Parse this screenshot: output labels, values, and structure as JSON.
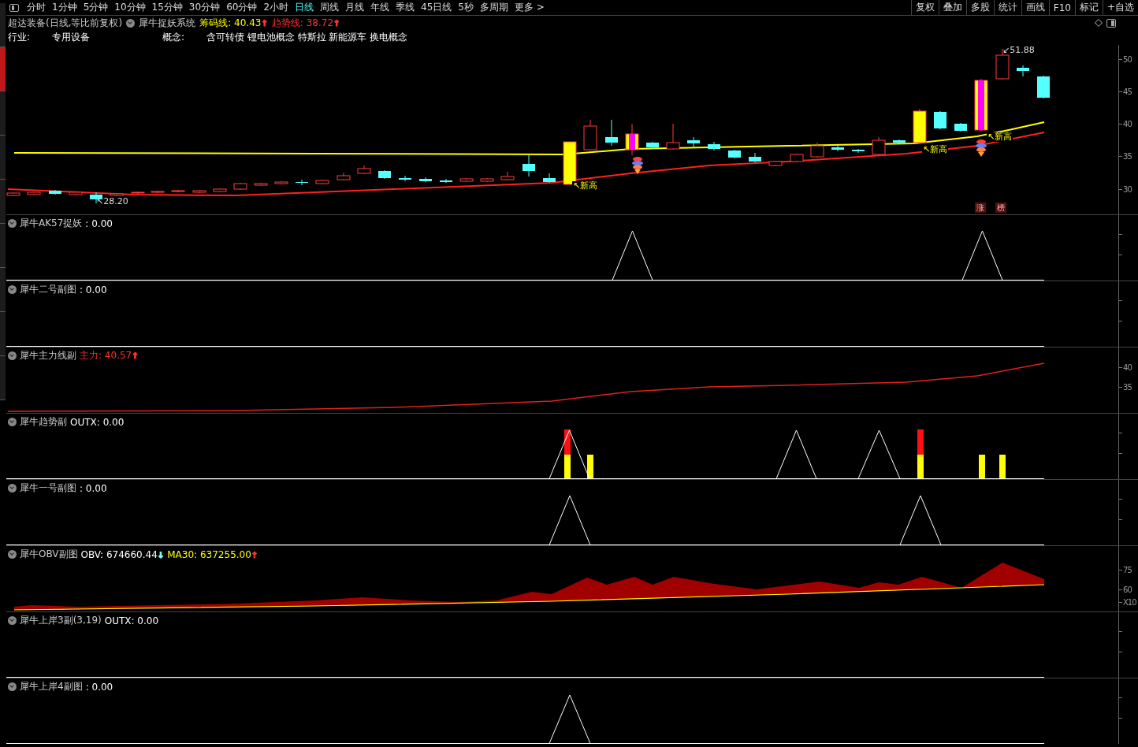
{
  "side_tabs": [
    {
      "selected": false
    },
    {
      "selected": true
    },
    {
      "selected": false
    },
    {
      "selected": false
    },
    {
      "selected": false
    },
    {
      "selected": false
    },
    {
      "selected": false
    },
    {
      "selected": false
    },
    {
      "selected": false
    }
  ],
  "toolbar": {
    "periods": [
      {
        "label": "分时",
        "selected": false
      },
      {
        "label": "1分钟",
        "selected": false
      },
      {
        "label": "5分钟",
        "selected": false
      },
      {
        "label": "10分钟",
        "selected": false
      },
      {
        "label": "15分钟",
        "selected": false
      },
      {
        "label": "30分钟",
        "selected": false
      },
      {
        "label": "60分钟",
        "selected": false
      },
      {
        "label": "2小时",
        "selected": false
      },
      {
        "label": "日线",
        "selected": true
      },
      {
        "label": "周线",
        "selected": false
      },
      {
        "label": "月线",
        "selected": false
      },
      {
        "label": "年线",
        "selected": false
      },
      {
        "label": "季线",
        "selected": false
      },
      {
        "label": "45日线",
        "selected": false
      },
      {
        "label": "5秒",
        "selected": false
      },
      {
        "label": "多周期",
        "selected": false
      },
      {
        "label": "更多 >",
        "selected": false
      }
    ],
    "actions": [
      "复权",
      "叠加",
      "多股",
      "统计",
      "画线",
      "F10",
      "标记",
      "+自选"
    ]
  },
  "header": {
    "stock": "超达装备(日线,等比前复权)",
    "indicator": "犀牛捉妖系统",
    "values": [
      {
        "label": "筹码线: 40.43",
        "color": "#ffff00",
        "arrow": {
          "text": "↑",
          "color": "#ff3030"
        }
      },
      {
        "label": "趋势线: 38.72",
        "color": "#ff3030",
        "arrow": {
          "text": "↑",
          "color": "#ff3030"
        }
      }
    ]
  },
  "info": {
    "industry_label": "行业:",
    "industry": "专用设备",
    "concept_label": "概念:",
    "concepts": "含可转债 锂电池概念 特斯拉 新能源车 换电概念"
  },
  "main_chart": {
    "axis_labels": [
      "50",
      "45",
      "40",
      "35",
      "30"
    ],
    "low_label": "↖28.20",
    "high_label": "↙51.88",
    "new_high_marks": [
      "↖新高",
      "↖新高",
      "↖新高"
    ],
    "badges": [
      "涨",
      "榜"
    ]
  },
  "panels": [
    {
      "kind": "ak57",
      "name": "犀牛AK57捉妖",
      "values": [
        {
          "label": ": 0.00",
          "color": "#ffffff"
        }
      ]
    },
    {
      "kind": "erhao",
      "name": "犀牛二号副图",
      "values": [
        {
          "label": ": 0.00",
          "color": "#ffffff"
        }
      ]
    },
    {
      "kind": "zhuli",
      "name": "犀牛主力线副",
      "values": [
        {
          "label": "主力: 40.57",
          "color": "#ff3030",
          "arrow": {
            "text": "↑",
            "color": "#ff3030"
          }
        }
      ],
      "axis_labels": [
        "40",
        "35"
      ]
    },
    {
      "kind": "qushi",
      "name": "犀牛趋势副",
      "values": [
        {
          "label": "OUTX: 0.00",
          "color": "#ffffff"
        }
      ]
    },
    {
      "kind": "yihao",
      "name": "犀牛一号副图",
      "values": [
        {
          "label": ": 0.00",
          "color": "#ffffff"
        }
      ]
    },
    {
      "kind": "obv",
      "name": "犀牛OBV副图",
      "values": [
        {
          "label": "OBV: 674660.44",
          "color": "#ffffff",
          "arrow": {
            "text": "↓",
            "color": "#80ffff"
          }
        },
        {
          "label": "MA30: 637255.00",
          "color": "#ffff00",
          "arrow": {
            "text": "↑",
            "color": "#ff3030"
          }
        }
      ],
      "axis_labels": [
        "75",
        "60",
        "X10"
      ]
    },
    {
      "kind": "shangan3",
      "name": "犀牛上岸3副(3,19)",
      "values": [
        {
          "label": "OUTX: 0.00",
          "color": "#ffffff"
        }
      ]
    },
    {
      "kind": "shangan4",
      "name": "犀牛上岸4副图",
      "values": [
        {
          "label": ": 0.00",
          "color": "#ffffff"
        }
      ]
    }
  ]
}
